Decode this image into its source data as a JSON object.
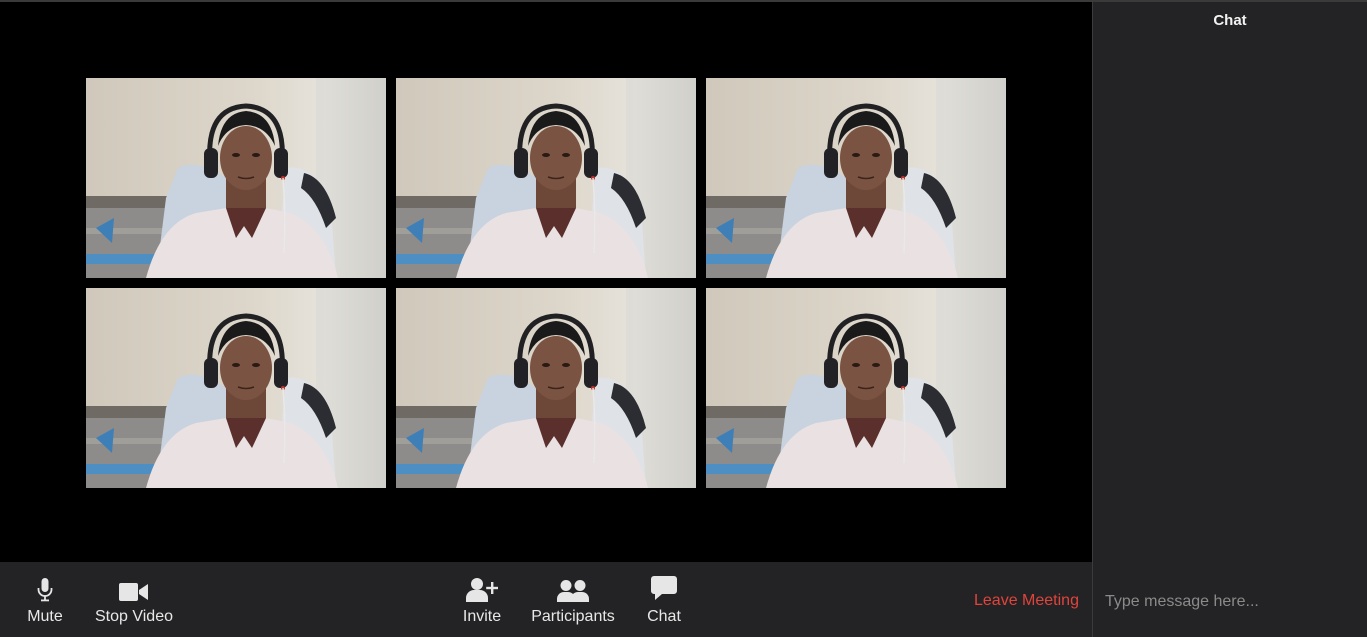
{
  "meeting": {
    "participant_tiles": [
      {
        "label": "participant-video-1"
      },
      {
        "label": "participant-video-2"
      },
      {
        "label": "participant-video-3"
      },
      {
        "label": "participant-video-4"
      },
      {
        "label": "participant-video-5"
      },
      {
        "label": "participant-video-6"
      }
    ]
  },
  "toolbar": {
    "mute_label": "Mute",
    "stop_video_label": "Stop Video",
    "invite_label": "Invite",
    "participants_label": "Participants",
    "chat_label": "Chat",
    "leave_label": "Leave Meeting",
    "icons": {
      "mute": "microphone-icon",
      "stop_video": "video-camera-icon",
      "invite": "add-user-icon",
      "participants": "people-icon",
      "chat": "speech-bubble-icon"
    },
    "leave_color": "#e0443b"
  },
  "chat_panel": {
    "title": "Chat",
    "input_placeholder": "Type message here..."
  }
}
